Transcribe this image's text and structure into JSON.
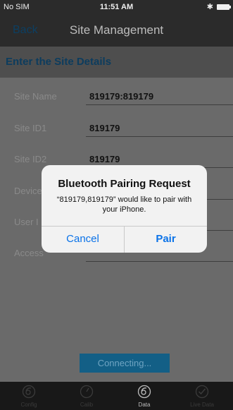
{
  "status_bar": {
    "carrier": "No SIM",
    "time": "11:51 AM",
    "bluetooth": "✱"
  },
  "nav": {
    "back_label": "Back",
    "title": "Site Management"
  },
  "section": {
    "title": "Enter the Site Details"
  },
  "fields": [
    {
      "label": "Site Name",
      "value": "819179:819179"
    },
    {
      "label": "Site ID1",
      "value": "819179"
    },
    {
      "label": "Site ID2",
      "value": "819179"
    },
    {
      "label": "Device",
      "value": ""
    },
    {
      "label": "User I",
      "value": ""
    },
    {
      "label": "Access",
      "value": ""
    }
  ],
  "connect_button": {
    "label": "Connecting..."
  },
  "dialog": {
    "title": "Bluetooth Pairing Request",
    "message": "“819179,819179” would like to pair with your iPhone.",
    "cancel_label": "Cancel",
    "pair_label": "Pair"
  },
  "tabs": [
    {
      "label": "Config",
      "icon": "config-icon"
    },
    {
      "label": "Calib",
      "icon": "calib-icon"
    },
    {
      "label": "Data",
      "icon": "data-icon",
      "active": true
    },
    {
      "label": "Live Data",
      "icon": "live-data-icon"
    }
  ],
  "colors": {
    "accent": "#0a72e8",
    "section_title": "#0c3c5e",
    "button": "#135f86"
  }
}
